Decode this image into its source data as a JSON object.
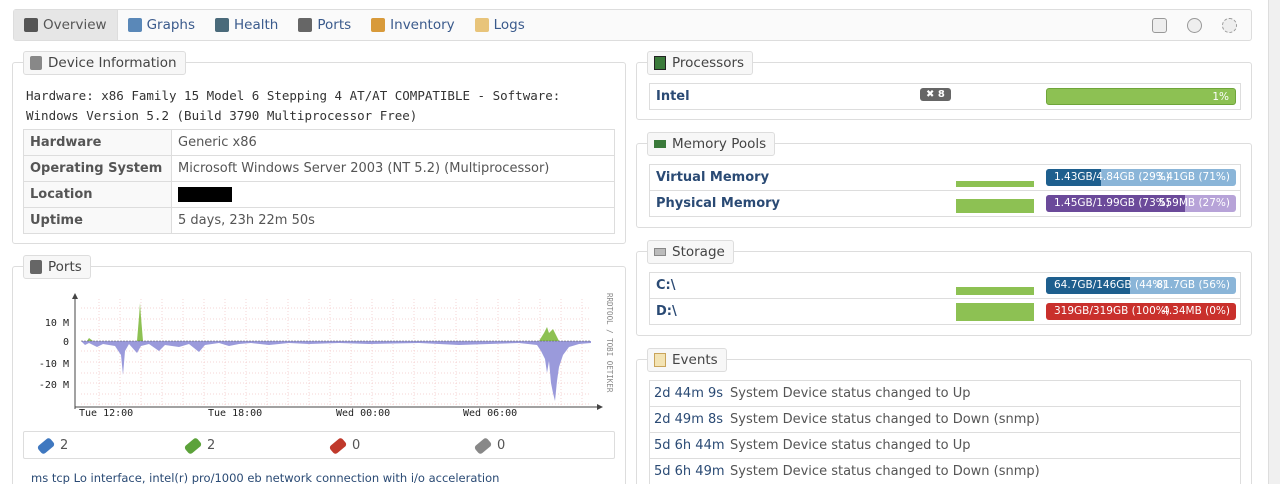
{
  "nav": {
    "tabs": [
      {
        "label": "Overview",
        "icon": "monitor-icon"
      },
      {
        "label": "Graphs",
        "icon": "graph-icon"
      },
      {
        "label": "Health",
        "icon": "health-icon"
      },
      {
        "label": "Ports",
        "icon": "ports-icon"
      },
      {
        "label": "Inventory",
        "icon": "inventory-icon"
      },
      {
        "label": "Logs",
        "icon": "logs-icon"
      }
    ],
    "right_icons": [
      "list-icon",
      "clock-icon",
      "gear-icon"
    ]
  },
  "device": {
    "title": "Device Information",
    "description_line1": "Hardware: x86 Family 15 Model 6 Stepping 4 AT/AT COMPATIBLE - Software:",
    "description_line2": "Windows Version 5.2 (Build 3790 Multiprocessor Free)",
    "rows": [
      {
        "key": "Hardware",
        "value": "Generic x86"
      },
      {
        "key": "Operating System",
        "value": "Microsoft Windows Server 2003 (NT 5.2) (Multiprocessor)"
      },
      {
        "key": "Location",
        "value": ""
      },
      {
        "key": "Uptime",
        "value": "5 days, 23h 22m 50s"
      }
    ]
  },
  "ports": {
    "title": "Ports",
    "graph": {
      "y_ticks": [
        "10 M",
        "0",
        "-10 M",
        "-20 M"
      ],
      "x_ticks": [
        "Tue 12:00",
        "Tue 18:00",
        "Wed 00:00",
        "Wed 06:00"
      ],
      "side_label": "RRDTOOL / TOBI OETIKER"
    },
    "counts": [
      "2",
      "2",
      "0",
      "0"
    ],
    "description": "ms tcp Lo interface, intel(r) pro/1000 eb network connection with i/o acceleration"
  },
  "processors": {
    "title": "Processors",
    "name": "Intel",
    "count_badge": "8",
    "usage_label": "1%",
    "usage_percent": 1
  },
  "memory": {
    "title": "Memory Pools",
    "items": [
      {
        "name": "Virtual Memory",
        "used": "1.43GB/4.84GB (29%)",
        "free": "3.41GB (71%)",
        "used_percent": 29,
        "mini_percent": 100
      },
      {
        "name": "Physical Memory",
        "used": "1.45GB/1.99GB (73%)",
        "free": "559MB (27%)",
        "used_percent": 73,
        "mini_percent": 100
      }
    ]
  },
  "storage": {
    "title": "Storage",
    "items": [
      {
        "name": "C:\\",
        "used": "64.7GB/146GB (44%)",
        "free": "81.7GB (56%)",
        "used_percent": 44
      },
      {
        "name": "D:\\",
        "used": "319GB/319GB (100%)",
        "free": "4.34MB (0%)",
        "used_percent": 100
      }
    ]
  },
  "events": {
    "title": "Events",
    "items": [
      {
        "time": "2d 44m 9s",
        "message": "System Device status changed to Up"
      },
      {
        "time": "2d 49m 8s",
        "message": "System Device status changed to Down (snmp)"
      },
      {
        "time": "5d 6h 44m",
        "message": "System Device status changed to Up"
      },
      {
        "time": "5d 6h 49m",
        "message": "System Device status changed to Down (snmp)"
      }
    ]
  },
  "colors": {
    "link": "#2a4a74",
    "green": "#7db94a",
    "blue": "#1e5f8e",
    "purple": "#6b4a9a",
    "red": "#c9302c"
  }
}
